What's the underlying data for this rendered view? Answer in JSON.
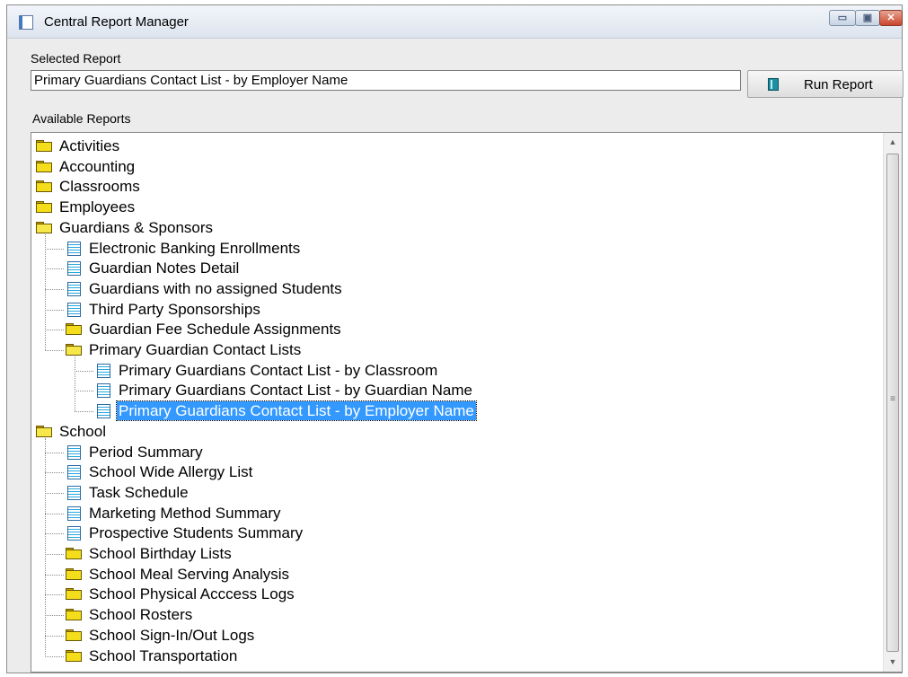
{
  "window": {
    "title": "Central Report Manager",
    "controls": {
      "minimize": "▭",
      "maximize": "▣",
      "close": "✕"
    }
  },
  "selected_report": {
    "label": "Selected Report",
    "value": "Primary Guardians Contact List - by Employer Name"
  },
  "run_report_button": {
    "label": "Run Report",
    "icon": "report-icon"
  },
  "available_reports": {
    "label": "Available Reports",
    "items": [
      {
        "label": "Activities",
        "type": "folder",
        "level": 0
      },
      {
        "label": "Accounting",
        "type": "folder",
        "level": 0
      },
      {
        "label": "Classrooms",
        "type": "folder",
        "level": 0
      },
      {
        "label": "Employees",
        "type": "folder",
        "level": 0
      },
      {
        "label": "Guardians & Sponsors",
        "type": "folder-open",
        "level": 0
      },
      {
        "label": "Electronic Banking Enrollments",
        "type": "report",
        "level": 1
      },
      {
        "label": "Guardian Notes Detail",
        "type": "report",
        "level": 1
      },
      {
        "label": "Guardians with no assigned Students",
        "type": "report",
        "level": 1
      },
      {
        "label": "Third Party Sponsorships",
        "type": "report",
        "level": 1
      },
      {
        "label": "Guardian Fee Schedule Assignments",
        "type": "folder",
        "level": 1
      },
      {
        "label": "Primary Guardian Contact Lists",
        "type": "folder-open",
        "level": 1
      },
      {
        "label": "Primary Guardians Contact List - by Classroom",
        "type": "report",
        "level": 2
      },
      {
        "label": "Primary Guardians Contact List - by Guardian Name",
        "type": "report",
        "level": 2
      },
      {
        "label": "Primary Guardians Contact List - by Employer Name",
        "type": "report",
        "level": 2,
        "selected": true
      },
      {
        "label": "School",
        "type": "folder-open",
        "level": 0
      },
      {
        "label": "Period Summary",
        "type": "report",
        "level": 1
      },
      {
        "label": "School Wide Allergy List",
        "type": "report",
        "level": 1
      },
      {
        "label": "Task Schedule",
        "type": "report",
        "level": 1
      },
      {
        "label": "Marketing Method Summary",
        "type": "report",
        "level": 1
      },
      {
        "label": "Prospective Students Summary",
        "type": "report",
        "level": 1
      },
      {
        "label": "School Birthday Lists",
        "type": "folder",
        "level": 1
      },
      {
        "label": "School Meal Serving Analysis",
        "type": "folder",
        "level": 1
      },
      {
        "label": "School Physical Acccess Logs",
        "type": "folder",
        "level": 1
      },
      {
        "label": "School Rosters",
        "type": "folder",
        "level": 1
      },
      {
        "label": "School Sign-In/Out Logs",
        "type": "folder",
        "level": 1
      },
      {
        "label": "School Transportation",
        "type": "folder",
        "level": 1
      }
    ]
  },
  "scrollbar": {
    "up": "▲",
    "down": "▼",
    "grip": "≡"
  },
  "colors": {
    "selection": "#3399ff",
    "folder": "#f4de1c",
    "report_icon": "#2aa8dd"
  }
}
